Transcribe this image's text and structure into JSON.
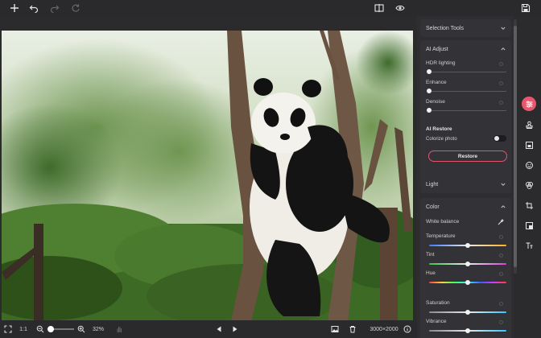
{
  "toolbar": {
    "icons": [
      "add-icon",
      "undo-icon",
      "redo-icon",
      "reset-icon",
      "compare-icon",
      "preview-eye-icon",
      "save-icon"
    ]
  },
  "bottom": {
    "fit_icon": "fit-screen-icon",
    "ratio_label": "1:1",
    "zoom_value": "32%",
    "zoom_fraction": 0.1,
    "dimensions": "3000×2000"
  },
  "panel": {
    "selection_tools": "Selection Tools",
    "ai_adjust": {
      "title": "AI Adjust",
      "sliders": [
        {
          "label": "HDR lighting",
          "value": 0
        },
        {
          "label": "Enhance",
          "value": 0
        },
        {
          "label": "Denoise",
          "value": 0
        }
      ]
    },
    "ai_restore": {
      "title": "AI Restore",
      "colorize_label": "Colorize photo",
      "colorize_on": false,
      "button": "Restore"
    },
    "light": "Light",
    "color": {
      "title": "Color",
      "white_balance": "White balance",
      "sliders": [
        {
          "label": "Temperature",
          "value": 0.5
        },
        {
          "label": "Tint",
          "value": 0.5
        },
        {
          "label": "Hue",
          "value": 0.5
        },
        {
          "label": "Saturation",
          "value": 0.5
        },
        {
          "label": "Vibrance",
          "value": 0.5
        }
      ]
    }
  },
  "colors": {
    "accent": "#e6566c",
    "background": "#2b2b2d",
    "panel": "#333337"
  }
}
